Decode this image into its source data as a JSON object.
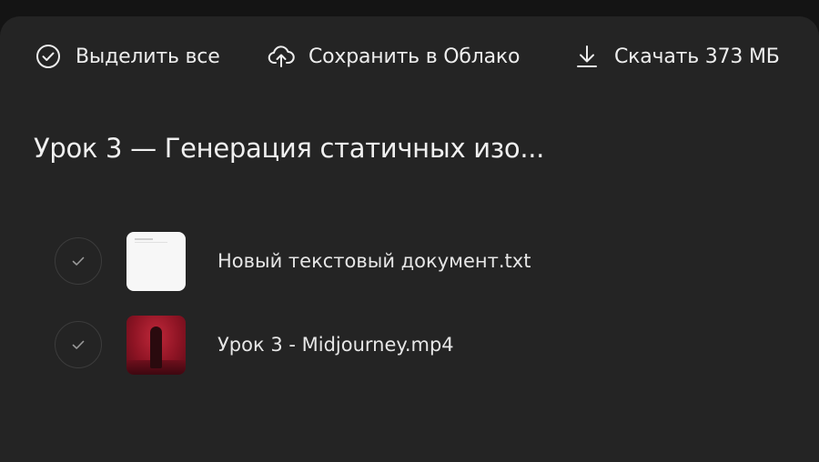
{
  "toolbar": {
    "select_all_label": "Выделить все",
    "save_cloud_label": "Сохранить в Облако",
    "download_label": "Скачать 373 МБ"
  },
  "folder_title": "Урок 3 — Генерация статичных изо...",
  "files": [
    {
      "name": "Новый текстовый документ.txt",
      "thumbnail": "text-document"
    },
    {
      "name": "Урок 3 - Midjourney.mp4",
      "thumbnail": "video-red-scene"
    }
  ],
  "colors": {
    "background": "#141414",
    "panel": "#242424",
    "text": "#e8e8e8",
    "check_border": "#3c3c3c",
    "check_mark": "#9a9a9a"
  }
}
